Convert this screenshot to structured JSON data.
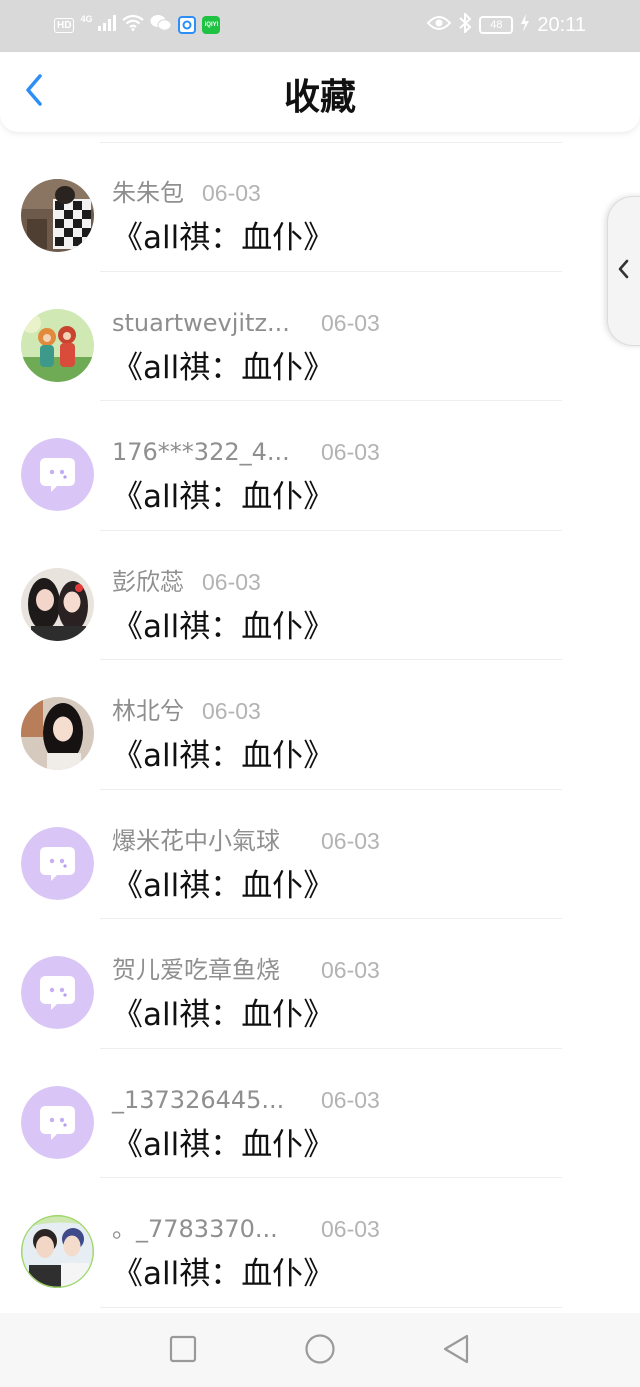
{
  "status_bar": {
    "network_badge": "HD",
    "signal_text": "4G",
    "app_badge": "iQIYI",
    "battery_level": "48",
    "time": "20:11"
  },
  "header": {
    "title": "收藏"
  },
  "favorites": [
    {
      "name": "朱朱包",
      "date": "06-03",
      "title": "《all祺：血仆》",
      "avatar": "photo-checkered"
    },
    {
      "name": "stuartwevjitz...",
      "date": "06-03",
      "title": "《all祺：血仆》",
      "avatar": "photo-illustration"
    },
    {
      "name": "176***322_4...",
      "date": "06-03",
      "title": "《all祺：血仆》",
      "avatar": "default-chat-bubble"
    },
    {
      "name": "彭欣蕊",
      "date": "06-03",
      "title": "《all祺：血仆》",
      "avatar": "photo-two-girls"
    },
    {
      "name": "林北兮",
      "date": "06-03",
      "title": "《all祺：血仆》",
      "avatar": "photo-girl-portrait"
    },
    {
      "name": "爆米花中小氣球",
      "date": "06-03",
      "title": "《all祺：血仆》",
      "avatar": "default-chat-bubble"
    },
    {
      "name": "贺儿爱吃章鱼烧",
      "date": "06-03",
      "title": "《all祺：血仆》",
      "avatar": "default-chat-bubble"
    },
    {
      "name": "_137326445...",
      "date": "06-03",
      "title": "《all祺：血仆》",
      "avatar": "default-chat-bubble"
    },
    {
      "name": "。_7783370...",
      "date": "06-03",
      "title": "《all祺：血仆》",
      "avatar": "photo-two-boys"
    }
  ],
  "colors": {
    "accent": "#2c8ef6",
    "default_avatar_bg": "#d9c6f7",
    "status_bar_bg": "#d9d9d9",
    "name_text": "#8f8f8f",
    "date_text": "#b3b3b3",
    "title_text": "#111111"
  },
  "icons": {
    "back": "chevron-left-icon",
    "side_handle": "chevron-left-icon",
    "nav_recents": "square-icon",
    "nav_home": "circle-icon",
    "nav_back": "triangle-left-icon"
  }
}
